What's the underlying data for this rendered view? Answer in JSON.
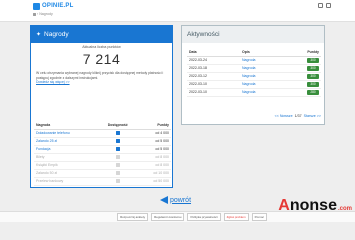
{
  "header": {
    "logo_text": "OPINIE.PL",
    "breadcrumb": "Nagrody"
  },
  "rewards_panel": {
    "title": "Nagrody",
    "points_label": "Aktualna liczba punktów",
    "points_value": "7 214",
    "description": "W celu otrzymania wybranej nagrody kliknij przycisk dla dostępnej metody płatności i postępuj zgodnie z dalszymi instrukcjami.",
    "details_link": "Dowiedz się więcej >>",
    "columns": [
      "Nagroda",
      "Dostępność",
      "Punkty"
    ],
    "rows": [
      {
        "name": "Doładowanie telefonu",
        "available": true,
        "points": "od 4 000"
      },
      {
        "name": "Zalando 25 zł",
        "available": true,
        "points": "od 5 000"
      },
      {
        "name": "Fundacja",
        "available": true,
        "points": "od 5 000"
      },
      {
        "name": "Bilety",
        "available": false,
        "points": "od 8 000"
      },
      {
        "name": "Książki Empik",
        "available": false,
        "points": "od 8 000"
      },
      {
        "name": "Zalando 50 zł",
        "available": false,
        "points": "od 10 000"
      },
      {
        "name": "Przelew bankowy",
        "available": false,
        "points": "od 50 000"
      }
    ]
  },
  "activity_panel": {
    "title": "Aktywności",
    "columns": [
      "Data",
      "Opis",
      "Punkty"
    ],
    "rows": [
      {
        "date": "2022-03-24",
        "desc": "Nagroda",
        "points": "300"
      },
      {
        "date": "2022-03-18",
        "desc": "Nagroda",
        "points": "300"
      },
      {
        "date": "2022-03-12",
        "desc": "Nagroda",
        "points": "300"
      },
      {
        "date": "2022-03-10",
        "desc": "Nagroda",
        "points": "300"
      },
      {
        "date": "2022-03-10",
        "desc": "Nagroda",
        "points": "280"
      }
    ],
    "pager": {
      "newer": "<< Nowsze",
      "page": "1/37",
      "older": "Starsze >>"
    }
  },
  "back": {
    "label": "powrót"
  },
  "footer": {
    "buttons": [
      "Rozpocznij ankiety",
      "Regulamin konkursu",
      "Polityka prywatności",
      "Zgłoś problem",
      "Pomoc"
    ]
  },
  "watermark": {
    "a": "A",
    "rest": "nonse",
    "domain": ".com"
  },
  "colors": {
    "primary": "#1976d2",
    "badge": "#388e3c",
    "warn": "#e53935"
  }
}
